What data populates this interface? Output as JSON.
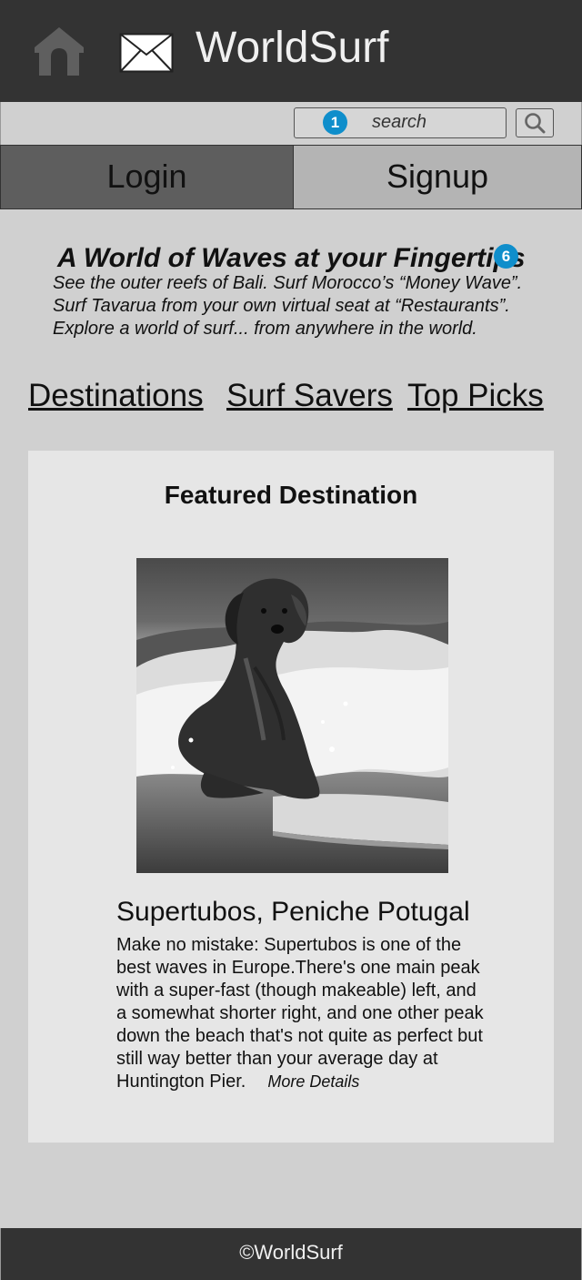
{
  "header": {
    "title": "WorldSurf",
    "home_icon": "home-icon",
    "mail_icon": "mail-icon"
  },
  "search": {
    "badge": "1",
    "placeholder": "search",
    "button_icon": "search-icon"
  },
  "auth": {
    "login_label": "Login",
    "signup_label": "Signup"
  },
  "hero": {
    "title": "A World of Waves at your Fingertips",
    "badge": "6",
    "lines": [
      "See the outer reefs of Bali. Surf Morocco’s “Money Wave”.",
      "Surf Tavarua from your own virtual seat at “Restaurants”.",
      "Explore a world of surf... from anywhere in the world."
    ]
  },
  "nav": {
    "links": [
      "Destinations",
      "Surf Savers",
      "Top Picks"
    ]
  },
  "featured": {
    "heading": "Featured Destination",
    "image_alt": "dog-surfing-photo",
    "name": "Supertubos, Peniche Potugal",
    "description_lines": [
      "Make no mistake: Supertubos is one of the",
      "best waves in Europe.There's one main peak",
      "with a super-fast (though makeable) left, and",
      "a somewhat shorter right, and one other peak",
      "down the beach that's not quite as perfect but",
      "still way better than your average day at",
      "Huntington Pier."
    ],
    "more_label": "More Details"
  },
  "footer": {
    "text": "©WorldSurf"
  },
  "colors": {
    "header_bg": "#333333",
    "page_bg": "#d0d0d0",
    "card_bg": "#e6e6e6",
    "badge": "#0f8ecb",
    "login_tab": "#5e5e5e",
    "signup_tab": "#b4b4b4"
  }
}
